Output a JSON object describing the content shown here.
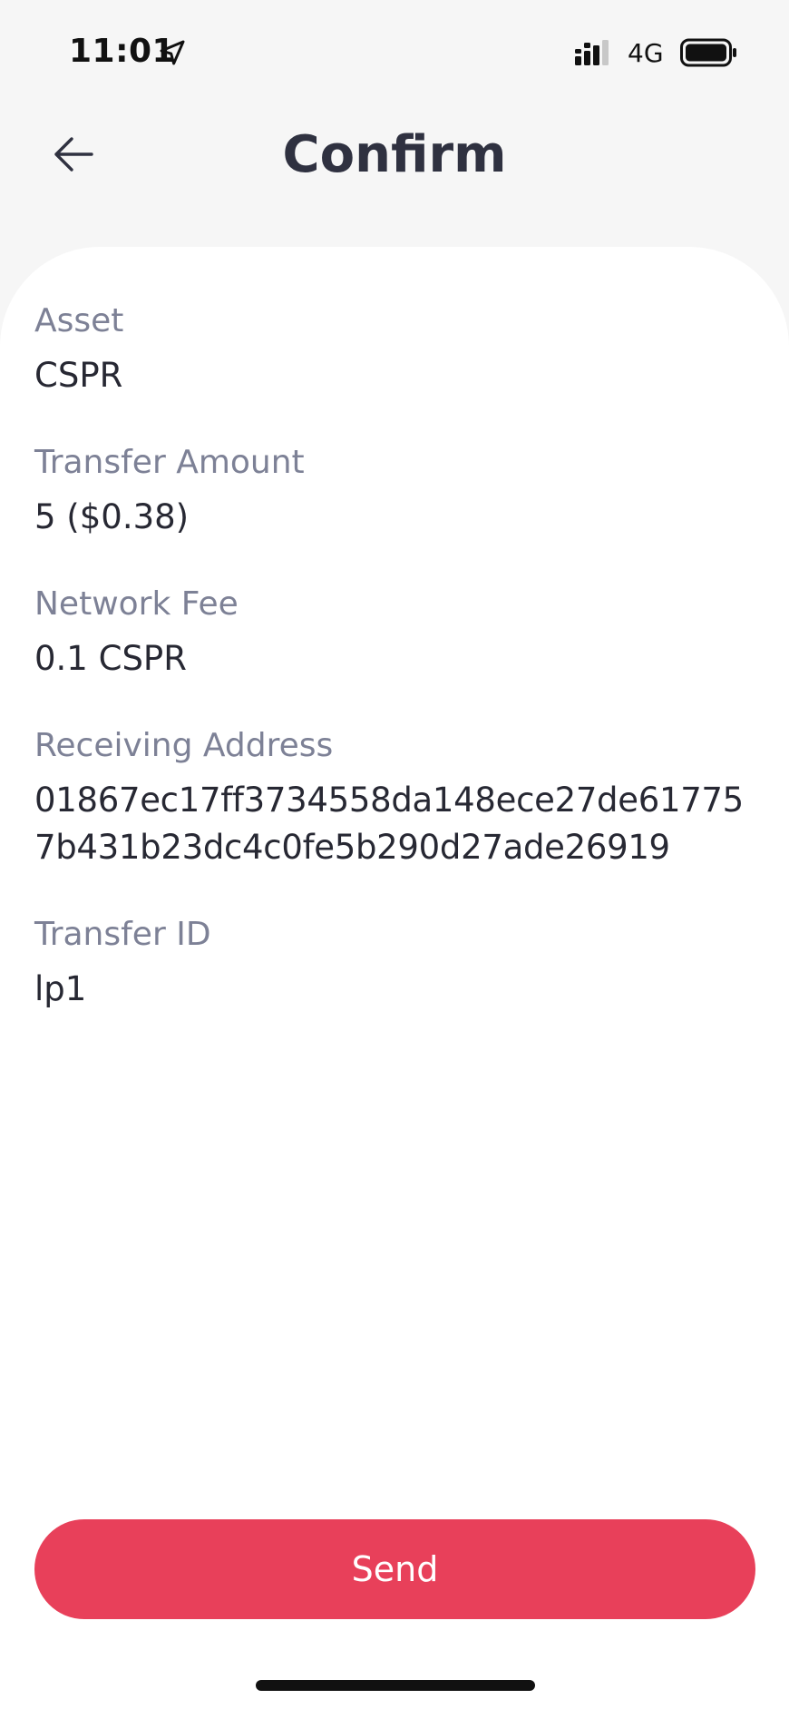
{
  "status_bar": {
    "time": "11:01",
    "network": "4G",
    "icons": [
      "location-arrow-icon",
      "signal-icon",
      "battery-icon"
    ]
  },
  "header": {
    "title": "Confirm",
    "back_icon": "arrow-left-icon"
  },
  "fields": {
    "asset": {
      "label": "Asset",
      "value": "CSPR"
    },
    "transfer_amount": {
      "label": "Transfer Amount",
      "value": "5 ($0.38)"
    },
    "network_fee": {
      "label": "Network Fee",
      "value": "0.1 CSPR"
    },
    "receiving_address": {
      "label": "Receiving Address",
      "value": "01867ec17ff3734558da148ece27de617757b431b23dc4c0fe5b290d27ade26919"
    },
    "transfer_id": {
      "label": "Transfer ID",
      "value": "lp1"
    }
  },
  "send_button": {
    "label": "Send"
  },
  "colors": {
    "accent": "#e8405a",
    "background": "#f6f6f6",
    "card": "#ffffff",
    "label": "#7d8196",
    "text": "#272833"
  }
}
